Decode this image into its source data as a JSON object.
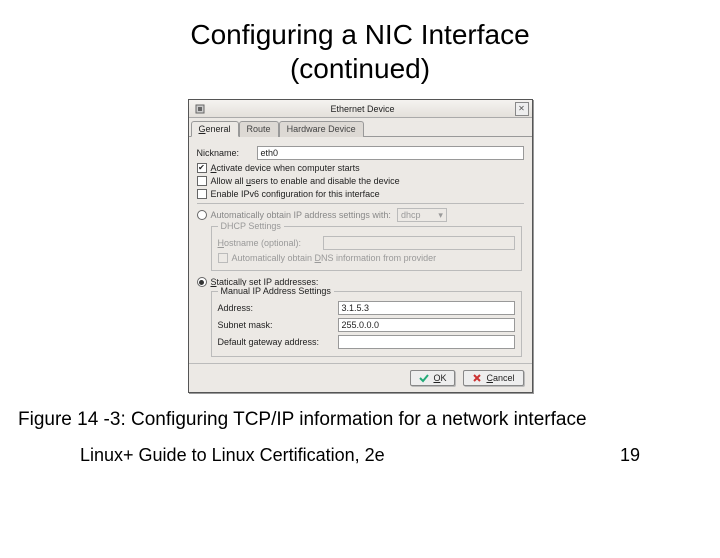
{
  "slide": {
    "title_line1": "Configuring a NIC Interface",
    "title_line2": "(continued)",
    "caption": "Figure 14 -3: Configuring TCP/IP information for a network interface",
    "book": "Linux+ Guide to Linux Certification, 2e",
    "page": "19"
  },
  "dialog": {
    "title": "Ethernet Device",
    "tabs": {
      "general": "General",
      "route": "Route",
      "hardware": "Hardware Device"
    },
    "nickname_label": "Nickname:",
    "nickname_value": "eth0",
    "chk_activate": "Activate device when computer starts",
    "chk_allow_users": "Allow all users to enable and disable the device",
    "chk_ipv6": "Enable IPv6 configuration for this interface",
    "radio_auto": "Automatically obtain IP address settings with:",
    "dhcp_value": "dhcp",
    "dhcp_legend": "DHCP Settings",
    "hostname_label": "Hostname (optional):",
    "chk_auto_dns": "Automatically obtain DNS information from provider",
    "radio_static": "Statically set IP addresses:",
    "manual_legend": "Manual IP Address Settings",
    "address_label": "Address:",
    "address_value": "3.1.5.3",
    "subnet_label": "Subnet mask:",
    "subnet_value": "255.0.0.0",
    "gateway_label": "Default gateway address:",
    "gateway_value": "",
    "btn_ok": "OK",
    "btn_cancel": "Cancel"
  }
}
